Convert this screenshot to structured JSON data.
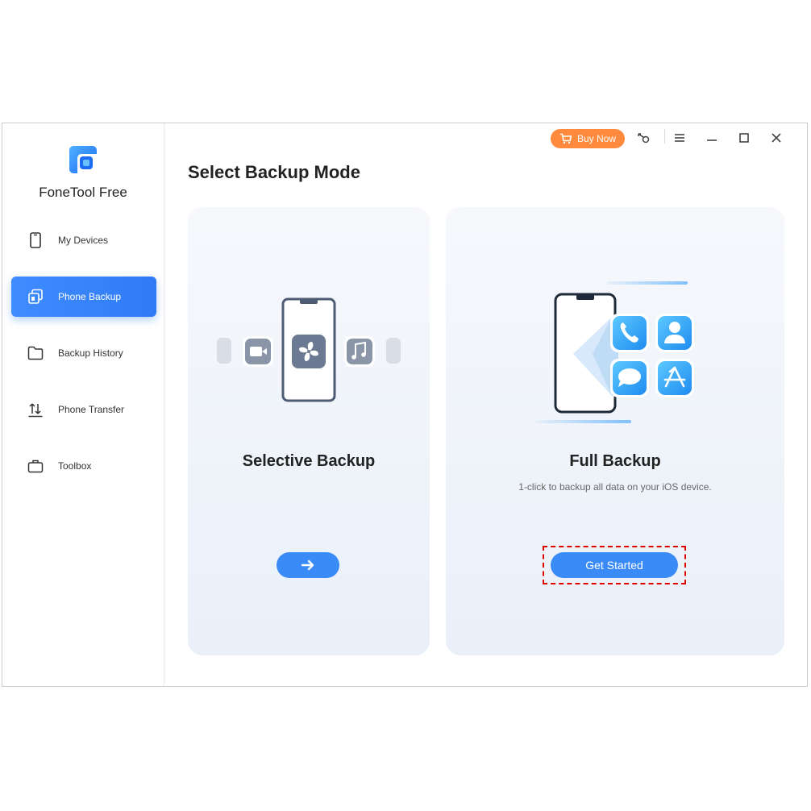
{
  "app": {
    "name": "FoneTool Free"
  },
  "sidebar": {
    "items": [
      {
        "label": "My Devices",
        "icon": "phone-icon",
        "active": false
      },
      {
        "label": "Phone Backup",
        "icon": "backup-icon",
        "active": true
      },
      {
        "label": "Backup History",
        "icon": "folder-icon",
        "active": false
      },
      {
        "label": "Phone Transfer",
        "icon": "transfer-icon",
        "active": false
      },
      {
        "label": "Toolbox",
        "icon": "toolbox-icon",
        "active": false
      }
    ]
  },
  "topbar": {
    "buy_label": "Buy Now",
    "icons": [
      "cart-icon",
      "key-icon",
      "menu-icon",
      "minimize-icon",
      "maximize-icon",
      "close-icon"
    ]
  },
  "main": {
    "title": "Select Backup Mode",
    "cards": [
      {
        "title": "Selective Backup",
        "description": "",
        "button": "arrow-right-icon"
      },
      {
        "title": "Full Backup",
        "description": "1-click to backup all data on your iOS device.",
        "button_label": "Get Started"
      }
    ]
  },
  "colors": {
    "accent": "#3a8bf7",
    "buy_button": "#ff8a3d",
    "highlight_border": "#e00000"
  }
}
